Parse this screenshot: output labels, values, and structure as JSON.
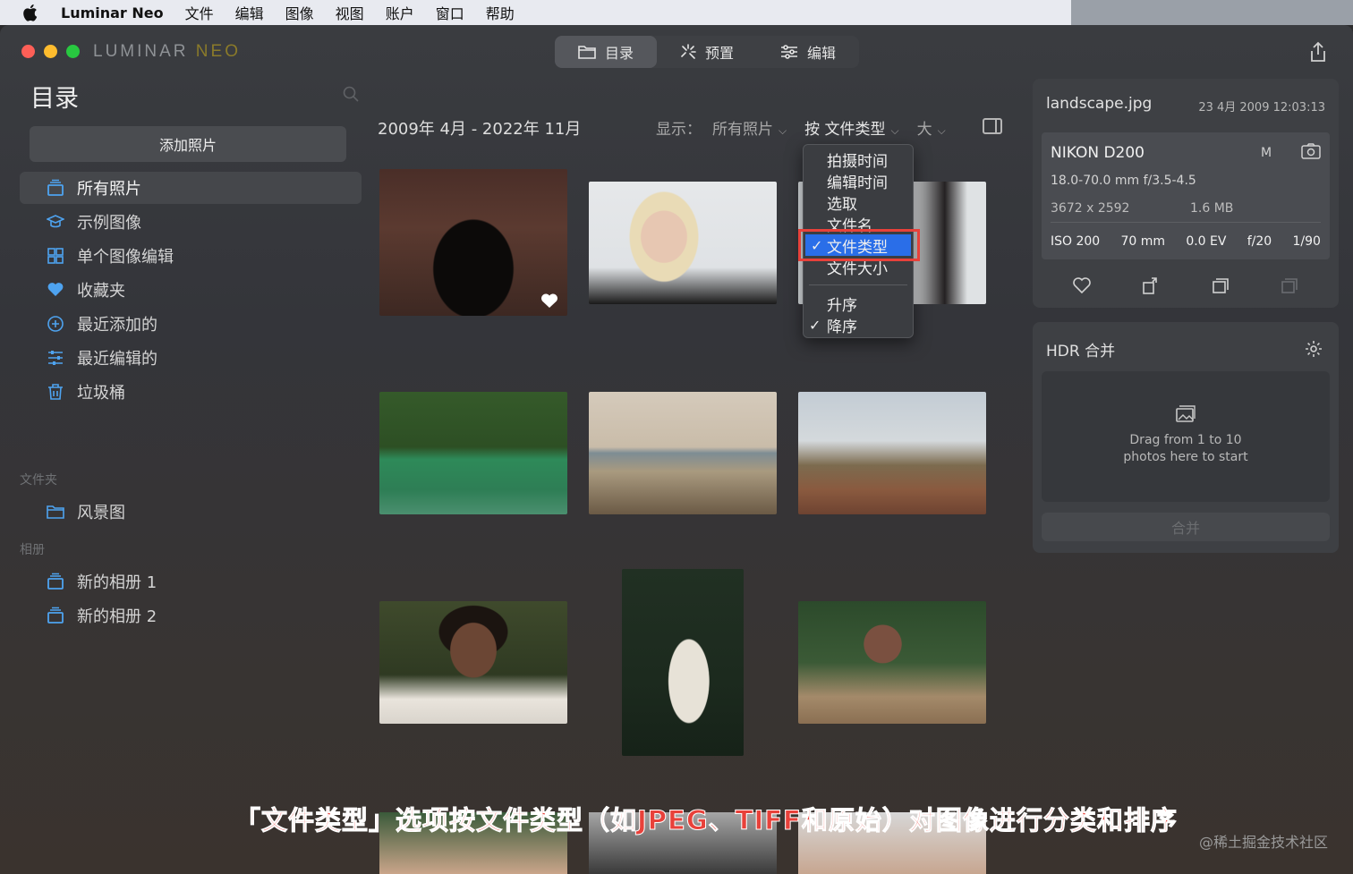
{
  "menubar": {
    "app_name": "Luminar Neo",
    "items": [
      "文件",
      "编辑",
      "图像",
      "视图",
      "账户",
      "窗口",
      "帮助"
    ]
  },
  "window": {
    "logo_main": "LUMINAR ",
    "logo_neo": "NEO",
    "tabs": [
      {
        "label": "目录",
        "icon": "folder-icon",
        "active": true
      },
      {
        "label": "预置",
        "icon": "sparkle-icon",
        "active": false
      },
      {
        "label": "编辑",
        "icon": "sliders-icon",
        "active": false
      }
    ]
  },
  "sidebar": {
    "title": "目录",
    "add_photos_label": "添加照片",
    "items": [
      {
        "label": "所有照片",
        "icon": "stack-icon",
        "active": true
      },
      {
        "label": "示例图像",
        "icon": "graduation-cap-icon",
        "active": false
      },
      {
        "label": "单个图像编辑",
        "icon": "grid-icon",
        "active": false
      },
      {
        "label": "收藏夹",
        "icon": "heart-icon",
        "active": false
      },
      {
        "label": "最近添加的",
        "icon": "plus-circle-icon",
        "active": false
      },
      {
        "label": "最近编辑的",
        "icon": "sliders-icon",
        "active": false
      },
      {
        "label": "垃圾桶",
        "icon": "trash-icon",
        "active": false
      }
    ],
    "folders_label": "文件夹",
    "folders": [
      {
        "label": "风景图",
        "icon": "folder-icon"
      }
    ],
    "albums_label": "相册",
    "albums": [
      {
        "label": "新的相册 1",
        "icon": "stack-icon"
      },
      {
        "label": "新的相册 2",
        "icon": "stack-icon"
      }
    ]
  },
  "main": {
    "date_range": "2009年 4月 - 2022年 11月",
    "show_label": "显示：",
    "show_value": "所有照片",
    "sort_value": "按 文件类型",
    "size_value": "大"
  },
  "sort_menu": {
    "items": [
      {
        "label": "拍摄时间",
        "checked": false
      },
      {
        "label": "编辑时间",
        "checked": false
      },
      {
        "label": "选取",
        "checked": false
      },
      {
        "label": "文件名",
        "checked": false
      },
      {
        "label": "文件类型",
        "checked": true
      },
      {
        "label": "文件大小",
        "checked": false
      }
    ],
    "order": [
      {
        "label": "升序",
        "checked": false
      },
      {
        "label": "降序",
        "checked": true
      }
    ],
    "check_mark": "✓"
  },
  "info": {
    "file_name": "landscape.jpg",
    "date": "23 4月 2009 12:03:13",
    "camera": "NIKON D200",
    "mode": "M",
    "lens": "18.0-70.0 mm f/3.5-4.5",
    "resolution": "3672 x 2592",
    "file_size": "1.6 MB",
    "iso": "ISO 200",
    "focal": "70 mm",
    "ev": "0.0 EV",
    "aperture": "f/20",
    "shutter": "1/90"
  },
  "hdr": {
    "title": "HDR 合并",
    "drop_line1": "Drag from 1 to 10",
    "drop_line2": "photos here to start",
    "merge_label": "合并"
  },
  "overlay": {
    "caption": "「文件类型」选项按文件类型（如JPEG、TIFF和原始）对图像进行分类和排序",
    "watermark": "@稀土掘金技术社区"
  },
  "colors": {
    "accent_selected": "#2a6ee8",
    "highlight_red": "#e8413a",
    "sidebar_icon_blue": "#4ea3f0"
  }
}
